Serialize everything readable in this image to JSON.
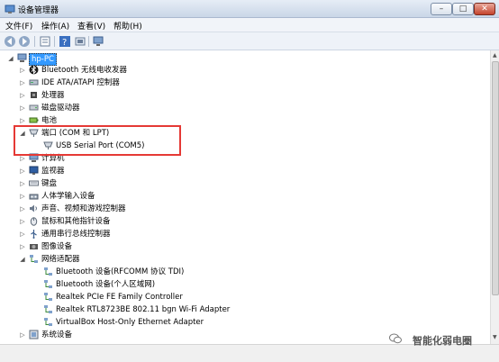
{
  "window": {
    "title": "设备管理器",
    "min_label": "–",
    "max_label": "□",
    "close_label": "✕"
  },
  "menu": [
    "文件(F)",
    "操作(A)",
    "查看(V)",
    "帮助(H)"
  ],
  "toolbar": {
    "buttons": [
      "back-icon",
      "forward-icon",
      "properties-icon",
      "help-icon",
      "scan-icon",
      "devices-icon"
    ]
  },
  "tree": {
    "root": "hp-PC",
    "items": [
      {
        "label": "Bluetooth 无线电收发器",
        "icon": "bluetooth-icon"
      },
      {
        "label": "IDE ATA/ATAPI 控制器",
        "icon": "ide-icon"
      },
      {
        "label": "处理器",
        "icon": "cpu-icon"
      },
      {
        "label": "磁盘驱动器",
        "icon": "disk-icon"
      },
      {
        "label": "电池",
        "icon": "battery-icon"
      },
      {
        "label": "端口 (COM 和 LPT)",
        "icon": "port-icon",
        "expanded": true
      },
      {
        "label": "USB Serial Port (COM5)",
        "icon": "port-icon",
        "child": true
      },
      {
        "label": "计算机",
        "icon": "computer-icon"
      },
      {
        "label": "监视器",
        "icon": "monitor-icon"
      },
      {
        "label": "键盘",
        "icon": "keyboard-icon"
      },
      {
        "label": "人体学输入设备",
        "icon": "hid-icon"
      },
      {
        "label": "声音、视频和游戏控制器",
        "icon": "sound-icon"
      },
      {
        "label": "鼠标和其他指针设备",
        "icon": "mouse-icon"
      },
      {
        "label": "通用串行总线控制器",
        "icon": "usb-icon"
      },
      {
        "label": "图像设备",
        "icon": "camera-icon"
      },
      {
        "label": "网络适配器",
        "icon": "network-icon",
        "expanded": true
      },
      {
        "label": "Bluetooth 设备(RFCOMM 协议 TDI)",
        "icon": "network-icon",
        "child": true
      },
      {
        "label": "Bluetooth 设备(个人区域网)",
        "icon": "network-icon",
        "child": true
      },
      {
        "label": "Realtek PCIe FE Family Controller",
        "icon": "network-icon",
        "child": true
      },
      {
        "label": "Realtek RTL8723BE 802.11 bgn Wi-Fi Adapter",
        "icon": "network-icon",
        "child": true
      },
      {
        "label": "VirtualBox Host-Only Ethernet Adapter",
        "icon": "network-icon",
        "child": true
      },
      {
        "label": "系统设备",
        "icon": "system-icon"
      }
    ]
  },
  "watermark": "智能化弱电圈",
  "colors": {
    "highlight_border": "#e53935",
    "selection": "#3399ff"
  }
}
